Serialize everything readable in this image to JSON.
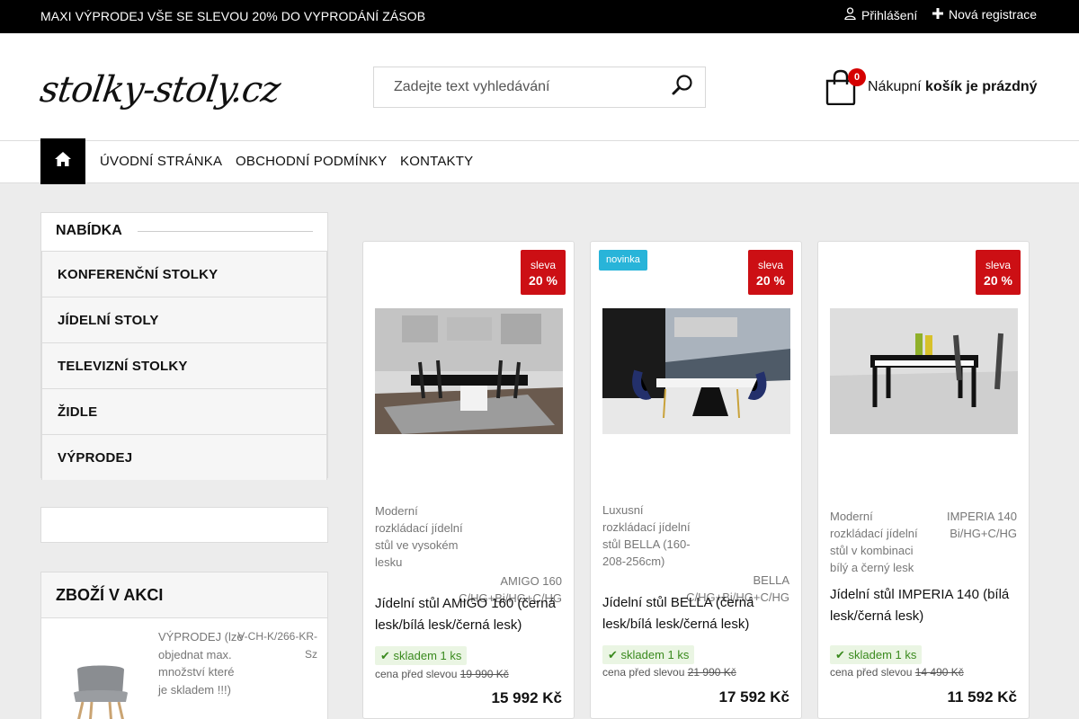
{
  "topbar": {
    "promo": "MAXI VÝPRODEJ VŠE SE SLEVOU 20% DO VYPRODÁNÍ ZÁSOB",
    "login": "Přihlášení",
    "register": "Nová registrace"
  },
  "header": {
    "logo": "stolky-stoly.cz",
    "search_placeholder": "Zadejte text vyhledávání",
    "cart_count": "0",
    "cart_label": "Nákupní",
    "cart_status": "košík je prázdný"
  },
  "nav": {
    "items": [
      "ÚVODNÍ STRÁNKA",
      "OBCHODNÍ PODMÍNKY",
      "KONTAKTY"
    ]
  },
  "sidebar": {
    "title": "NABÍDKA",
    "items": [
      "KONFERENČNÍ STOLKY",
      "JÍDELNÍ STOLY",
      "TELEVIZNÍ STOLKY",
      "ŽIDLE",
      "VÝPRODEJ"
    ],
    "akce_title": "ZBOŽÍ V AKCI",
    "akce_desc": "VÝPRODEJ (lze objednat max. množství které je skladem !!!)",
    "akce_code": "V-CH-K/266-KR-Sz"
  },
  "products": [
    {
      "sale_label": "sleva",
      "sale_value": "20 %",
      "desc": "Moderní rozkládací jídelní stůl ve vysokém lesku",
      "code": "AMIGO 160 C/HG+Bi/HG+C/HG",
      "name": "Jídelní stůl AMIGO 160 (černá lesk/bílá lesk/černá lesk)",
      "stock": "skladem 1 ks",
      "before_label": "cena před slevou",
      "before_price": "19 990 Kč",
      "price": "15 992 Kč"
    },
    {
      "badge_new": "novinka",
      "sale_label": "sleva",
      "sale_value": "20 %",
      "desc": "Luxusní rozkládací jídelní stůl BELLA (160-208-256cm)",
      "code": "BELLA C/HG+Bi/HG+C/HG",
      "name": "Jídelní stůl BELLA (černá lesk/bílá lesk/černá lesk)",
      "stock": "skladem 1 ks",
      "before_label": "cena před slevou",
      "before_price": "21 990 Kč",
      "price": "17 592 Kč"
    },
    {
      "sale_label": "sleva",
      "sale_value": "20 %",
      "desc": "Moderní rozkládací jídelní stůl v kombinaci bílý a černý lesk",
      "code": "IMPERIA 140 Bi/HG+C/HG",
      "name": "Jídelní stůl IMPERIA 140 (bílá lesk/černá lesk)",
      "stock": "skladem 1 ks",
      "before_label": "cena před slevou",
      "before_price": "14 490 Kč",
      "price": "11 592 Kč"
    }
  ],
  "colors": {
    "sale_badge": "#cc0f14",
    "new_badge": "#28b4d9",
    "cart_badge": "#d50000",
    "stock_text": "#3a8a1e"
  }
}
